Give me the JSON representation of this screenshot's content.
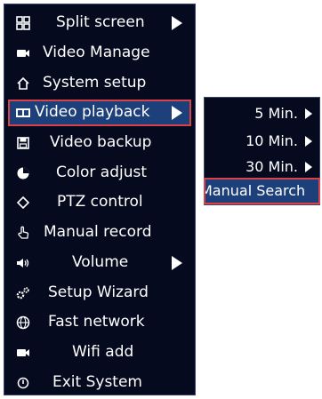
{
  "menu": {
    "items": [
      {
        "label": "Split screen",
        "icon": "grid-icon",
        "has_submenu": true
      },
      {
        "label": "Video Manage",
        "icon": "camera-icon",
        "has_submenu": false
      },
      {
        "label": "System setup",
        "icon": "home-icon",
        "has_submenu": false
      },
      {
        "label": "Video playback",
        "icon": "film-icon",
        "has_submenu": true,
        "selected": true
      },
      {
        "label": "Video backup",
        "icon": "floppy-disk-icon",
        "has_submenu": false
      },
      {
        "label": "Color adjust",
        "icon": "palette-icon",
        "has_submenu": false
      },
      {
        "label": "PTZ control",
        "icon": "ptz-icon",
        "has_submenu": false
      },
      {
        "label": "Manual record",
        "icon": "hand-pointer-icon",
        "has_submenu": false
      },
      {
        "label": "Volume",
        "icon": "speaker-icon",
        "has_submenu": true
      },
      {
        "label": "Setup Wizard",
        "icon": "gears-icon",
        "has_submenu": false
      },
      {
        "label": "Fast network",
        "icon": "globe-icon",
        "has_submenu": false
      },
      {
        "label": "Wifi add",
        "icon": "camera-icon",
        "has_submenu": false
      },
      {
        "label": "Exit System",
        "icon": "power-icon",
        "has_submenu": false
      }
    ]
  },
  "submenu": {
    "items": [
      {
        "label": "5 Min.",
        "has_submenu": true
      },
      {
        "label": "10 Min.",
        "has_submenu": true
      },
      {
        "label": "30 Min.",
        "has_submenu": true
      },
      {
        "label": "Manual Search",
        "has_submenu": false,
        "selected": true
      }
    ]
  },
  "colors": {
    "menu_background": "#050a1e",
    "selection_fill": "#1d3f7a",
    "selection_border": "#d8434b",
    "text": "#ffffff"
  }
}
